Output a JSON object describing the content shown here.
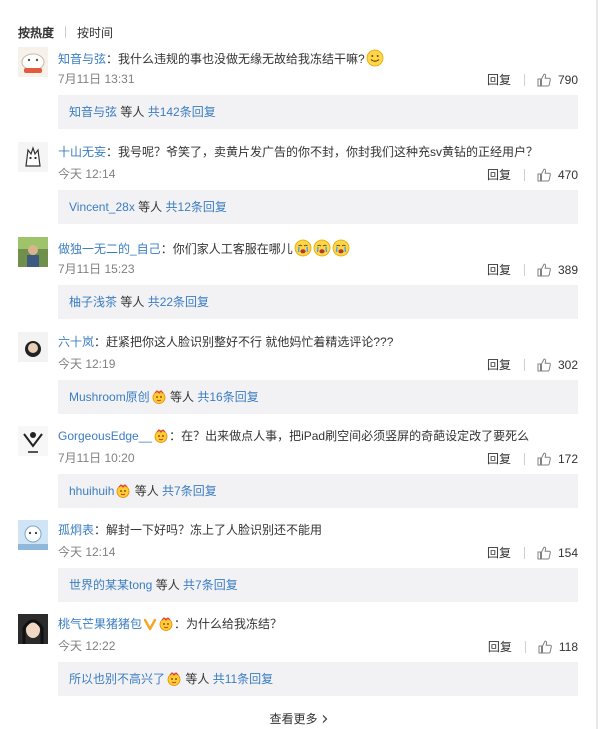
{
  "sort": {
    "hot": "按热度",
    "time": "按时间"
  },
  "comments": [
    {
      "user": "知音与弦",
      "text": "：我什么违规的事也没做无缘无故给我冻结干嘛?",
      "time": "7月11日 13:31",
      "reply_label": "回复",
      "likes": "790",
      "reply_user": "知音与弦",
      "reply_etc": " 等人 ",
      "reply_count": "共142条回复"
    },
    {
      "user": "十山无妄",
      "text": "：我号呢？爷笑了，卖黄片发广告的你不封，你封我们这种充sv黄钻的正经用户？",
      "time": "今天 12:14",
      "reply_label": "回复",
      "likes": "470",
      "reply_user": "Vincent_28x",
      "reply_etc": " 等人 ",
      "reply_count": "共12条回复"
    },
    {
      "user": "做独一无二的_自己",
      "text": "：你们家人工客服在哪儿",
      "time": "7月11日 15:23",
      "reply_label": "回复",
      "likes": "389",
      "reply_user": "柚子浅茶",
      "reply_etc": " 等人 ",
      "reply_count": "共22条回复"
    },
    {
      "user": "六十岚",
      "text": "：赶紧把你这人脸识别整好不行 就他妈忙着精选评论???",
      "time": "今天 12:19",
      "reply_label": "回复",
      "likes": "302",
      "reply_user": "Mushroom原创",
      "reply_etc": " 等人 ",
      "reply_count": "共16条回复"
    },
    {
      "user": "GorgeousEdge__",
      "text": "：在？出来做点人事，把iPad刷空间必须竖屏的奇葩设定改了要死么",
      "time": "7月11日 10:20",
      "reply_label": "回复",
      "likes": "172",
      "reply_user": "hhuihuih",
      "reply_etc": " 等人 ",
      "reply_count": "共7条回复"
    },
    {
      "user": "孤炯表",
      "text": "：解封一下好吗？冻上了人脸识别还不能用",
      "time": "今天 12:14",
      "reply_label": "回复",
      "likes": "154",
      "reply_user": "世界的某某tong",
      "reply_etc": " 等人 ",
      "reply_count": "共7条回复"
    },
    {
      "user": "桃气芒果猪猪包",
      "text": "：为什么给我冻结？",
      "time": "今天 12:22",
      "reply_label": "回复",
      "likes": "118",
      "reply_user": "所以也别不高兴了",
      "reply_etc": " 等人 ",
      "reply_count": "共11条回复"
    }
  ],
  "view_more": "查看更多"
}
